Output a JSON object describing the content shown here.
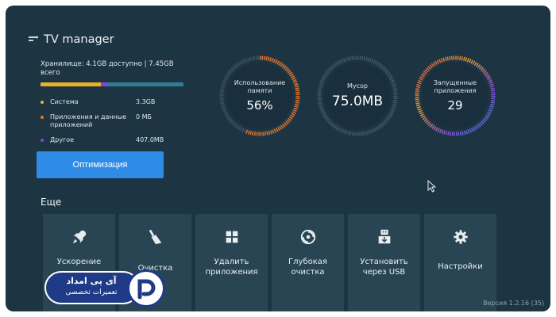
{
  "app": {
    "title": "TV manager"
  },
  "storage": {
    "summary": "Хранилище: 4.1GB доступно | 7.45GB всего",
    "bar": {
      "system": 0.42,
      "apps": 0.0,
      "other": 0.05
    },
    "legend": [
      {
        "name": "Система",
        "value": "3.3GB",
        "color": "#e6b325"
      },
      {
        "name": "Приложения и данные приложений",
        "value": "0 МБ",
        "color": "#e07a2b"
      },
      {
        "name": "Другое",
        "value": "407.0MB",
        "color": "#8b3fd6"
      }
    ]
  },
  "optimize_button": "Оптимизация",
  "gauges": [
    {
      "label": "Использование памяти",
      "value": "56%",
      "fill": 0.56
    },
    {
      "label": "Мусор",
      "value": "75.0MB",
      "fill": 0.0
    },
    {
      "label": "Запущенные приложения",
      "value": "29",
      "fill": 1.0
    }
  ],
  "more": {
    "title": "Еще",
    "tiles": [
      {
        "label": "Ускорение",
        "icon": "rocket-icon"
      },
      {
        "label": "Очистка",
        "icon": "broom-icon"
      },
      {
        "label": "Удалить приложения",
        "icon": "grid-icon"
      },
      {
        "label": "Глубокая очистка",
        "icon": "disc-icon"
      },
      {
        "label": "Установить через USB",
        "icon": "usb-install-icon"
      },
      {
        "label": "Настройки",
        "icon": "gear-icon"
      }
    ]
  },
  "version": "Версия 1.2.16 (35)",
  "watermark": {
    "line1": "آی پی امداد",
    "line2": "تعمیرات تخصصی"
  },
  "colors": {
    "background": "#1d3443",
    "tile": "#294554",
    "accent": "#2f8ce6"
  }
}
